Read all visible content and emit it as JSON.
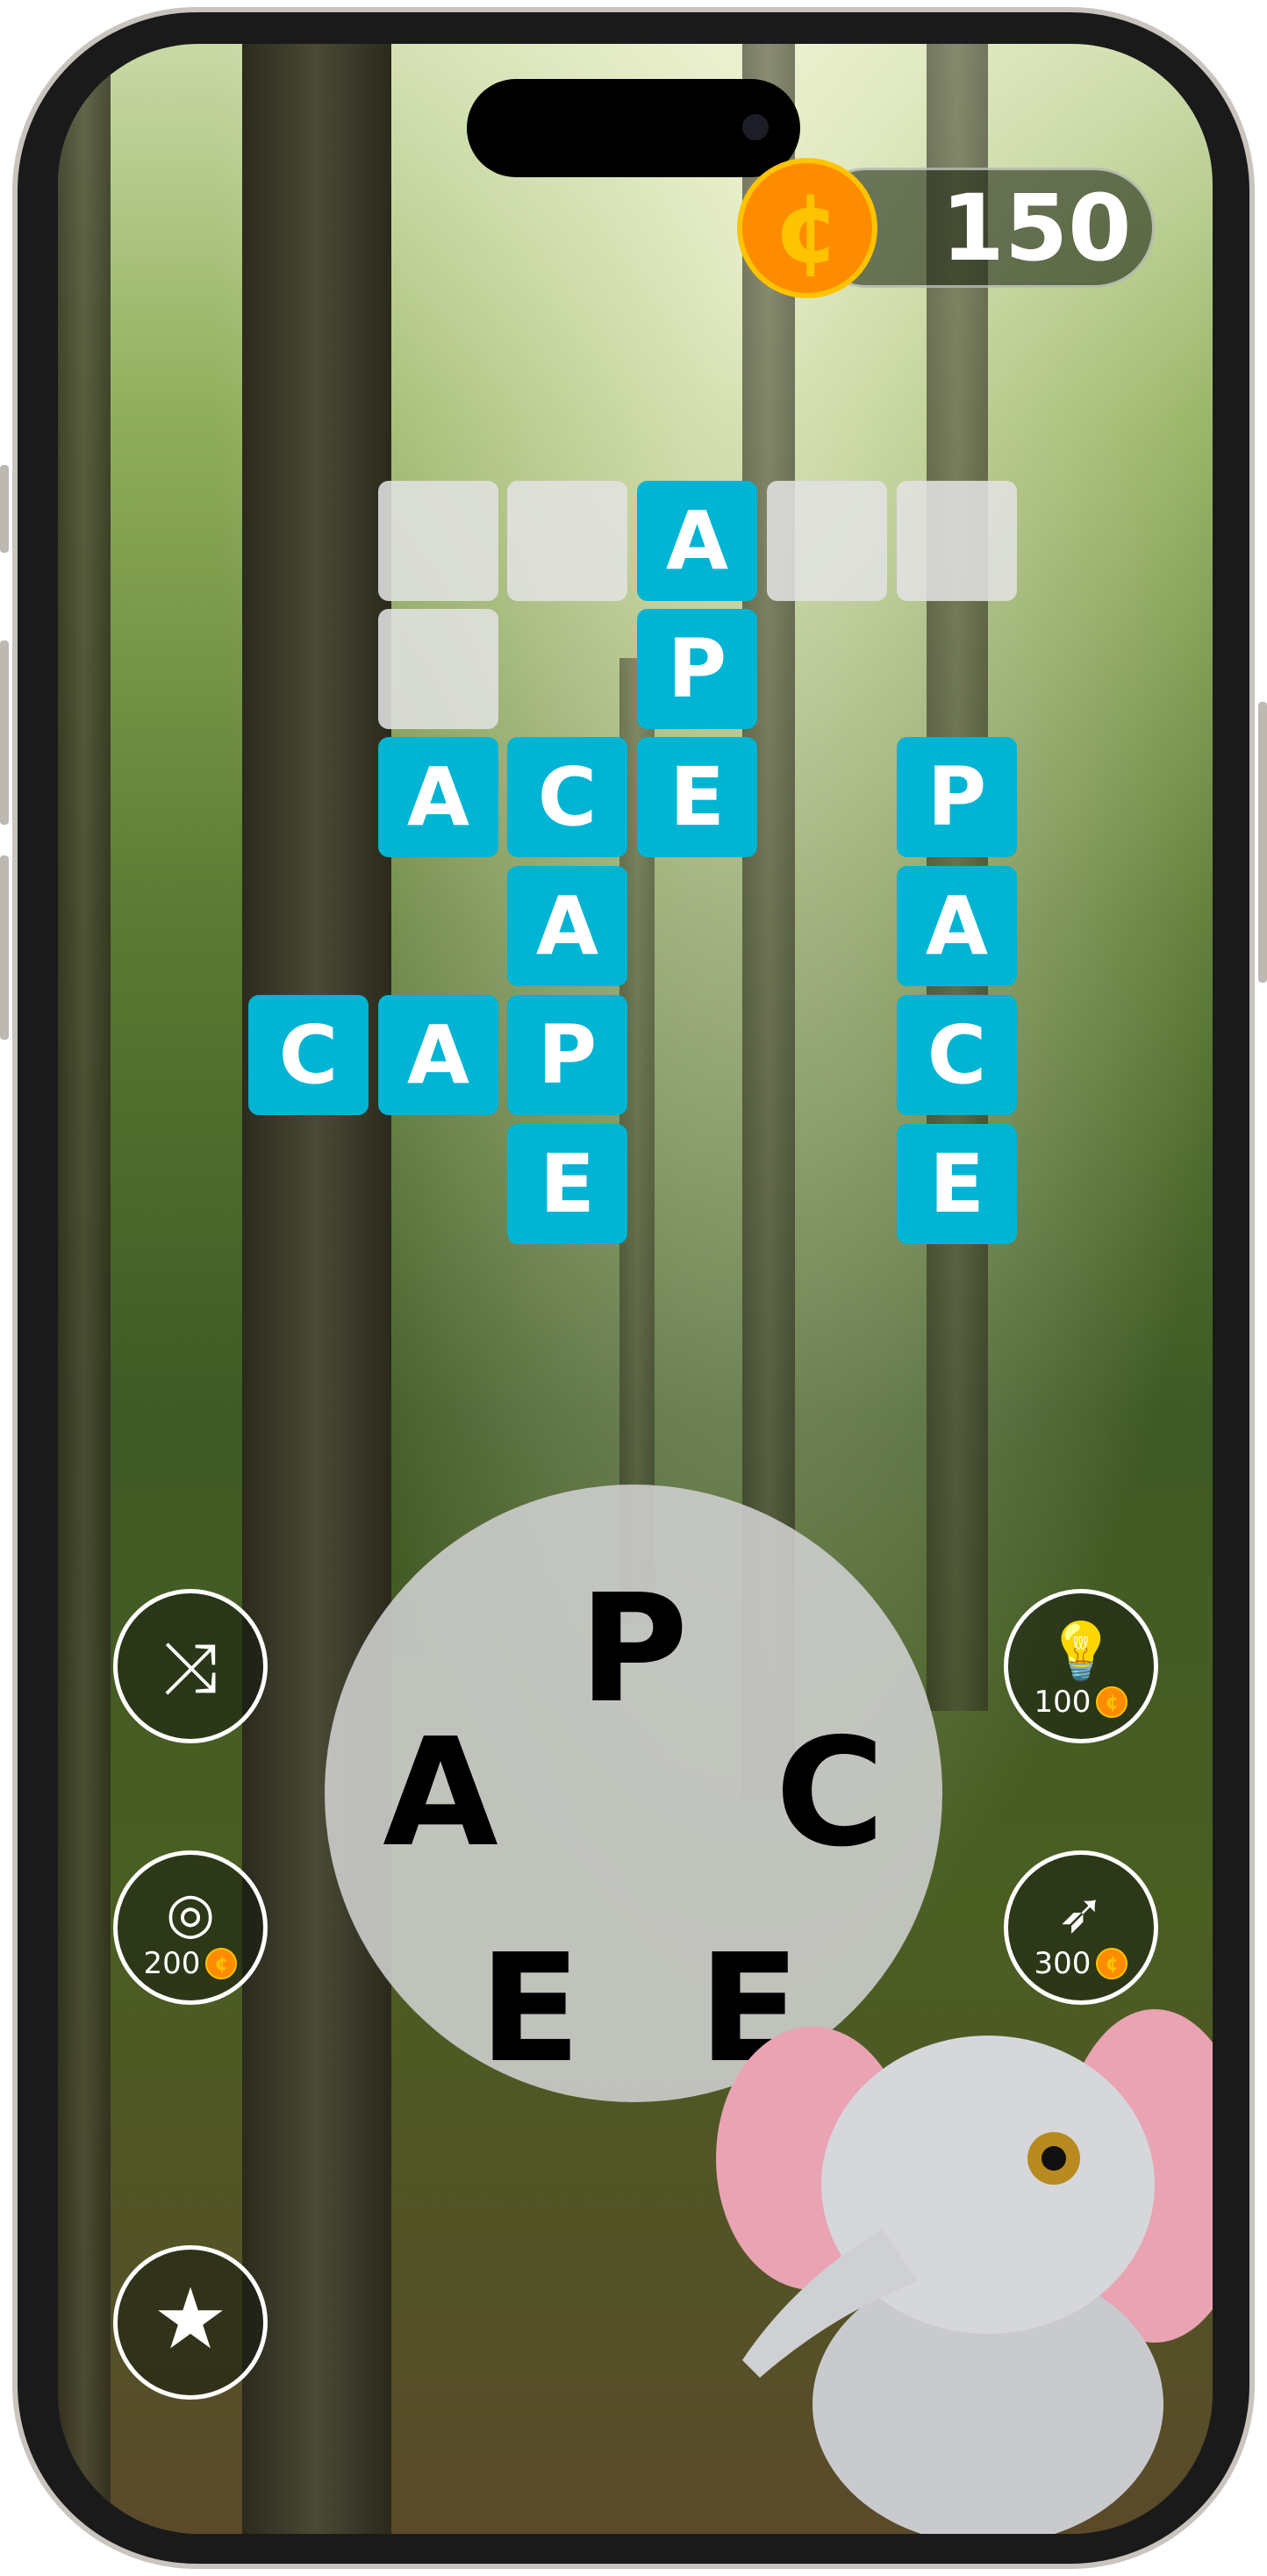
{
  "coins": {
    "value": "150",
    "icon": "cent-coin-icon",
    "color": "#ff8c00"
  },
  "board": {
    "tile_color": "#00b4d4",
    "rows": [
      [
        "",
        "",
        "",
        "A",
        "",
        "",
        ""
      ],
      [
        "",
        "",
        "",
        "P",
        "",
        "",
        ""
      ],
      [
        "",
        "A",
        "C",
        "E",
        "",
        "P",
        ""
      ],
      [
        "",
        "",
        "A",
        "",
        "",
        "A",
        ""
      ],
      [
        "C",
        "A",
        "P",
        "",
        "",
        "C",
        ""
      ],
      [
        "",
        "",
        "E",
        "",
        "",
        "E",
        ""
      ]
    ],
    "empty_cells": [
      [
        0,
        1
      ],
      [
        0,
        2
      ],
      [
        0,
        4
      ],
      [
        0,
        5
      ],
      [
        1,
        1
      ]
    ]
  },
  "wheel": {
    "letters": [
      "P",
      "A",
      "C",
      "E",
      "E"
    ]
  },
  "buttons": {
    "shuffle": {
      "icon": "shuffle-icon"
    },
    "hint": {
      "icon": "lightbulb-icon",
      "cost": "100"
    },
    "target": {
      "icon": "target-icon",
      "cost": "200"
    },
    "rocket": {
      "icon": "rocket-icon",
      "cost": "300"
    },
    "star": {
      "icon": "star-icon"
    }
  }
}
